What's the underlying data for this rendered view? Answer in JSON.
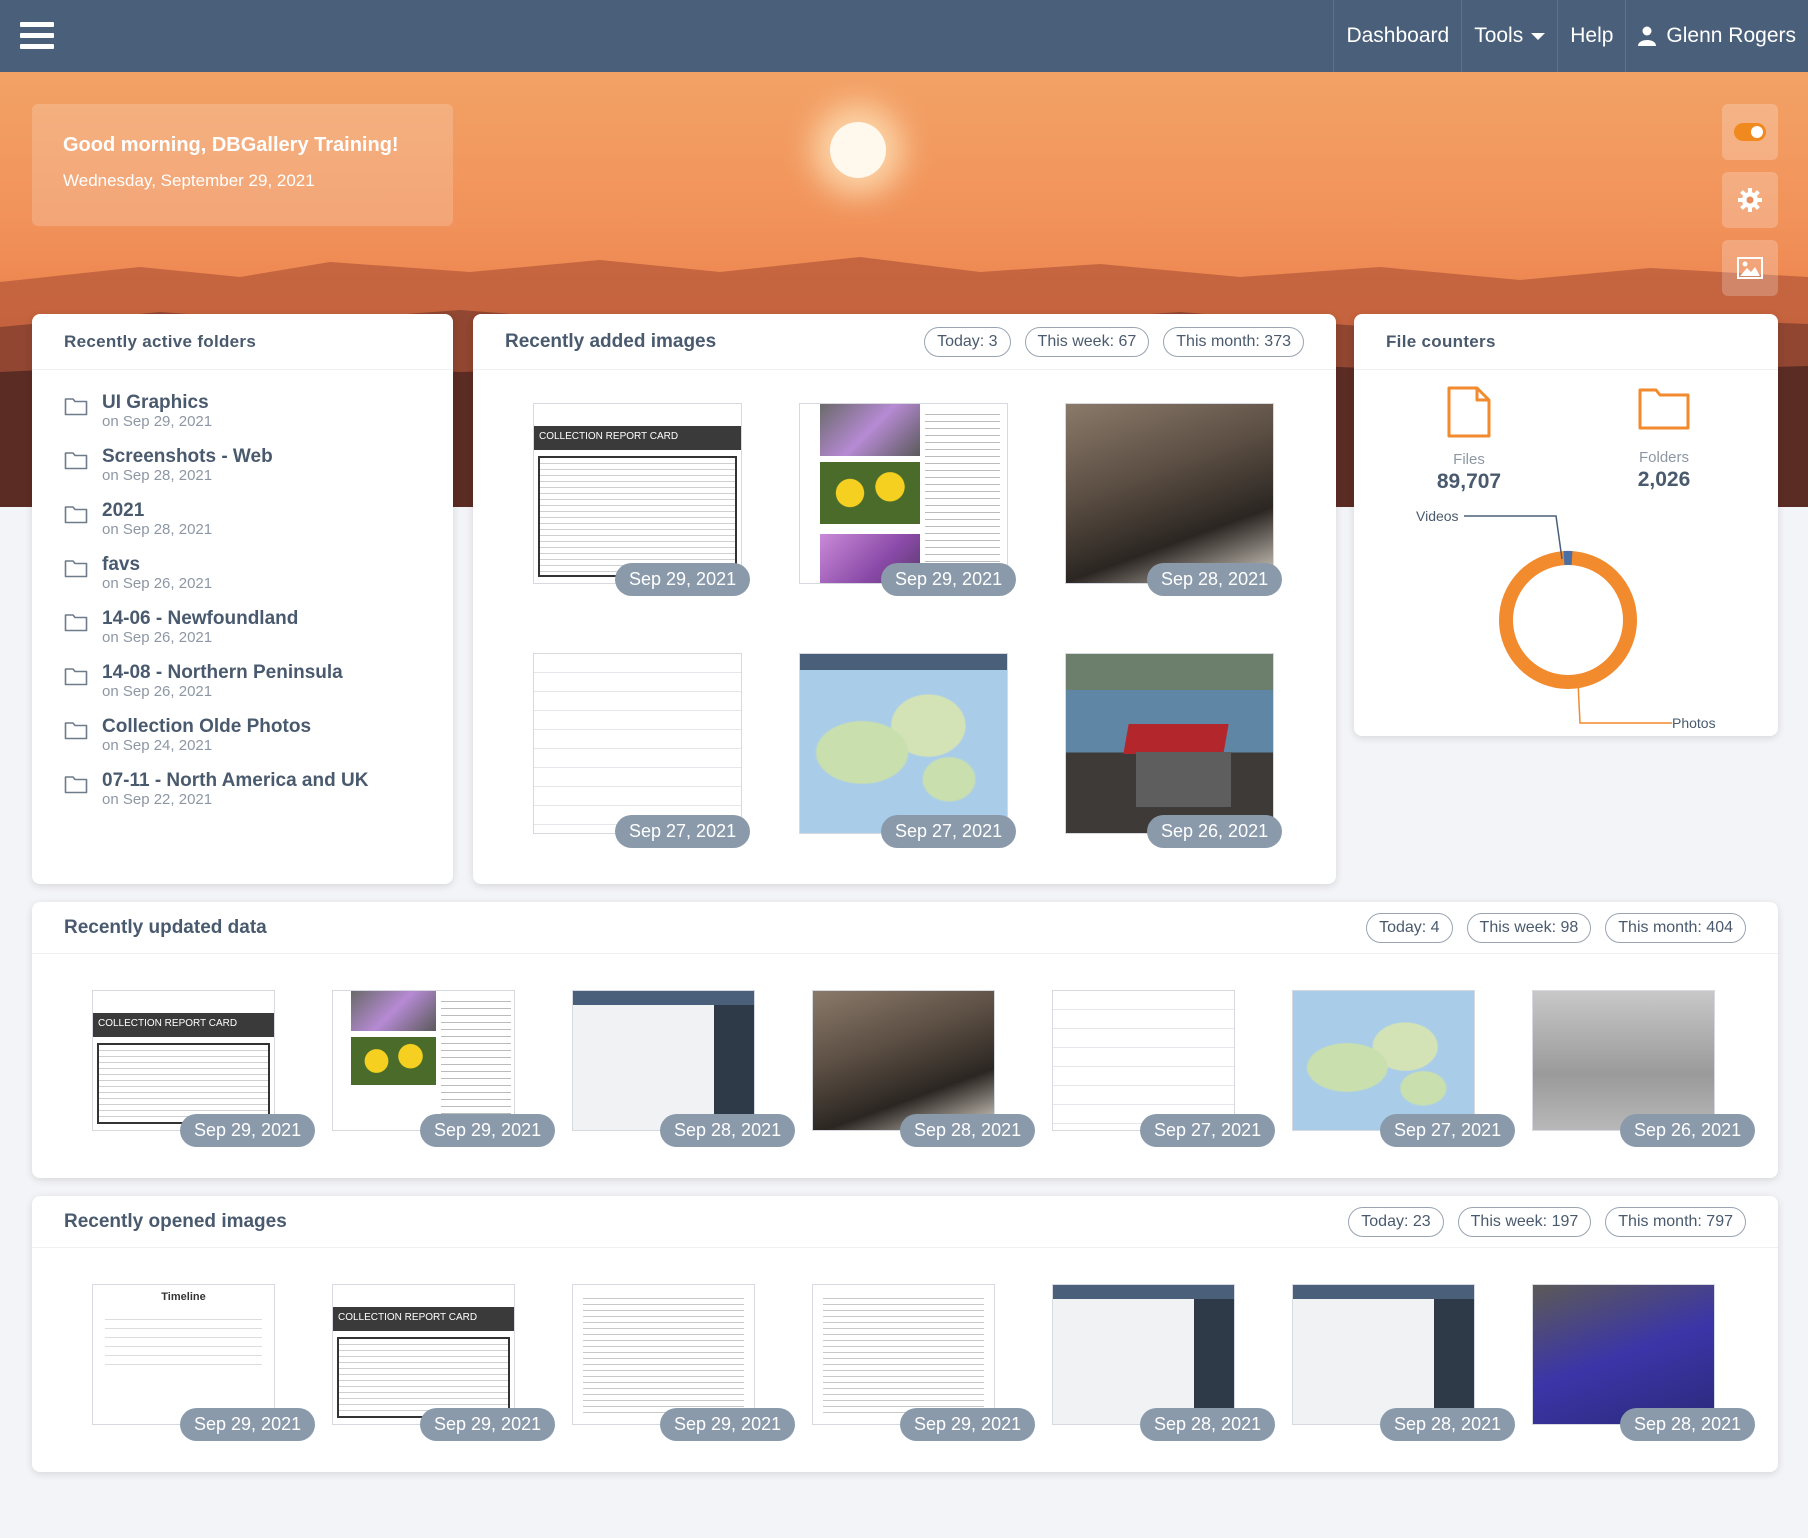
{
  "nav": {
    "dashboard": "Dashboard",
    "tools": "Tools",
    "help": "Help",
    "user": "Glenn Rogers"
  },
  "greeting": {
    "title": "Good morning, DBGallery Training!",
    "date": "Wednesday, September 29, 2021"
  },
  "folders": {
    "title": "Recently active folders",
    "items": [
      {
        "name": "UI Graphics",
        "date": "on Sep 29, 2021"
      },
      {
        "name": "Screenshots - Web",
        "date": "on Sep 28, 2021"
      },
      {
        "name": "2021",
        "date": "on Sep 28, 2021"
      },
      {
        "name": "favs",
        "date": "on Sep 26, 2021"
      },
      {
        "name": "14-06 - Newfoundland",
        "date": "on Sep 26, 2021"
      },
      {
        "name": "14-08 - Northern Peninsula",
        "date": "on Sep 26, 2021"
      },
      {
        "name": "Collection Olde Photos",
        "date": "on Sep 24, 2021"
      },
      {
        "name": "07-11 - North America and UK",
        "date": "on Sep 22, 2021"
      }
    ]
  },
  "recently_added": {
    "title": "Recently added images",
    "today": "Today: 3",
    "week": "This week: 67",
    "month": "This month: 373",
    "images": [
      {
        "date": "Sep 29, 2021"
      },
      {
        "date": "Sep 29, 2021"
      },
      {
        "date": "Sep 28, 2021"
      },
      {
        "date": "Sep 27, 2021"
      },
      {
        "date": "Sep 27, 2021"
      },
      {
        "date": "Sep 26, 2021"
      }
    ]
  },
  "counters": {
    "title": "File counters",
    "files_label": "Files",
    "files_value": "89,707",
    "folders_label": "Folders",
    "folders_value": "2,026",
    "donut_videos": "Videos",
    "donut_photos": "Photos",
    "accent": "#f28a2e"
  },
  "updated": {
    "title": "Recently updated data",
    "today": "Today: 4",
    "week": "This week: 98",
    "month": "This month: 404",
    "images": [
      {
        "date": "Sep 29, 2021"
      },
      {
        "date": "Sep 29, 2021"
      },
      {
        "date": "Sep 28, 2021"
      },
      {
        "date": "Sep 28, 2021"
      },
      {
        "date": "Sep 27, 2021"
      },
      {
        "date": "Sep 27, 2021"
      },
      {
        "date": "Sep 26, 2021"
      }
    ]
  },
  "opened": {
    "title": "Recently opened images",
    "today": "Today: 23",
    "week": "This week: 197",
    "month": "This month: 797",
    "images": [
      {
        "date": "Sep 29, 2021"
      },
      {
        "date": "Sep 29, 2021"
      },
      {
        "date": "Sep 29, 2021"
      },
      {
        "date": "Sep 29, 2021"
      },
      {
        "date": "Sep 28, 2021"
      },
      {
        "date": "Sep 28, 2021"
      },
      {
        "date": "Sep 28, 2021"
      }
    ]
  },
  "thumb_text": {
    "report": "COLLECTION REPORT CARD",
    "timeline": "Timeline"
  }
}
